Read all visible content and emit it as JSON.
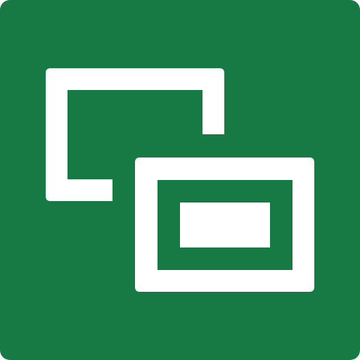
{
  "icon": {
    "name": "screen-snip-window-icon",
    "background_color": "#177A44",
    "foreground_color": "#FFFFFF"
  }
}
